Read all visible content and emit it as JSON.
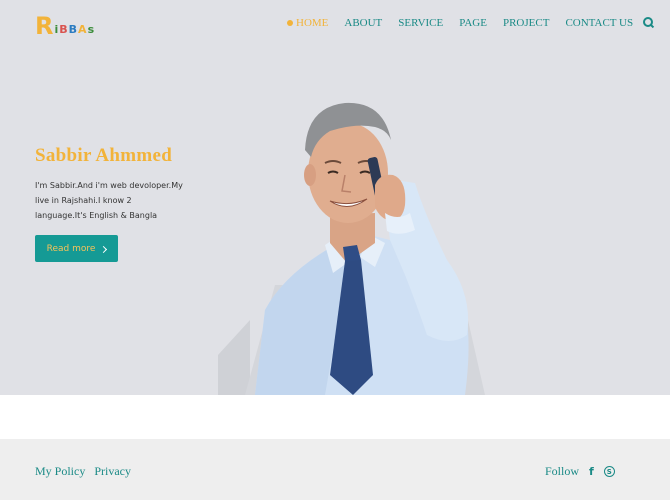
{
  "brand": {
    "logo_initial": "R",
    "logo_rest": [
      "i",
      "B",
      "B",
      "A",
      "s"
    ]
  },
  "nav": {
    "items": [
      {
        "label": "HOME",
        "active": true
      },
      {
        "label": "ABOUT"
      },
      {
        "label": "SERVICE"
      },
      {
        "label": "PAGE"
      },
      {
        "label": "PROJECT"
      },
      {
        "label": "CONTACT US"
      }
    ],
    "search_icon": "search-icon"
  },
  "hero": {
    "title": "Sabbir Ahmmed",
    "description": "I'm Sabbir.And i'm web devoloper.My live in Rajshahi.I know 2 language.It's English & Bangla",
    "button_label": "Read more"
  },
  "footer": {
    "links": [
      "My Policy",
      "Privacy"
    ],
    "follow_label": "Follow",
    "social": [
      "facebook-icon",
      "skype-icon"
    ]
  },
  "colors": {
    "accent": "#f2b33a",
    "teal": "#1a8a86",
    "button": "#159a95",
    "hero_bg": "#e0e1e6",
    "footer_bg": "#eeeeee"
  }
}
